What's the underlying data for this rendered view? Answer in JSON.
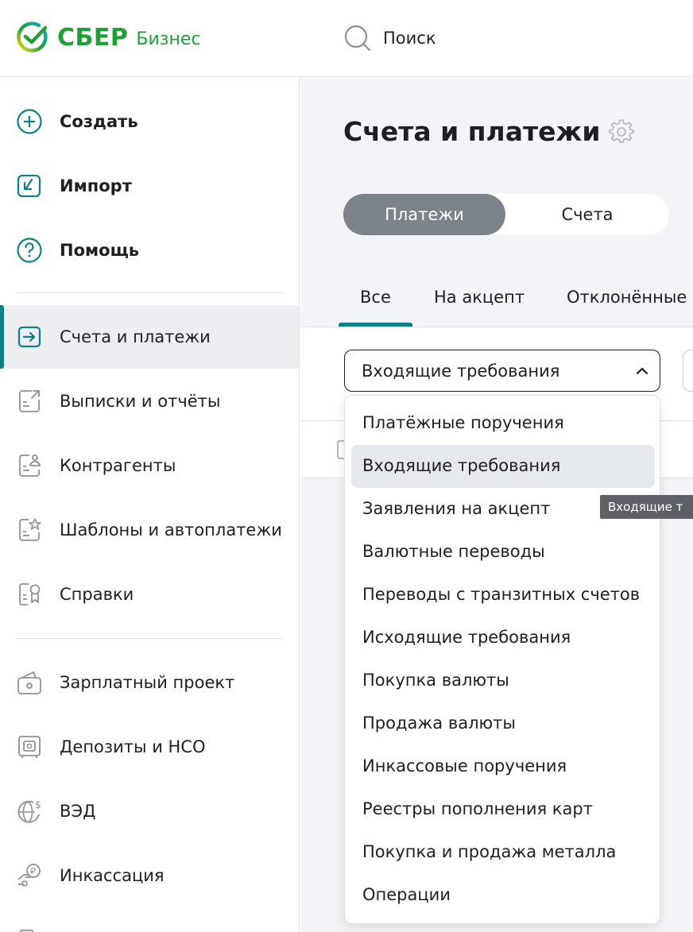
{
  "header": {
    "logo_brand": "СБЕР",
    "logo_product": "Бизнес",
    "search_label": "Поиск"
  },
  "sidebar": {
    "actions": [
      {
        "label": "Создать",
        "icon": "plus-circle-icon"
      },
      {
        "label": "Импорт",
        "icon": "import-icon"
      },
      {
        "label": "Помощь",
        "icon": "help-icon"
      }
    ],
    "nav": [
      {
        "label": "Счета и платежи",
        "icon": "arrow-box-icon",
        "active": true
      },
      {
        "label": "Выписки и отчёты",
        "icon": "statement-icon"
      },
      {
        "label": "Контрагенты",
        "icon": "contractors-icon"
      },
      {
        "label": "Шаблоны и автоплатежи",
        "icon": "templates-icon"
      },
      {
        "label": "Справки",
        "icon": "certificate-icon"
      }
    ],
    "services": [
      {
        "label": "Зарплатный проект",
        "icon": "wallet-icon"
      },
      {
        "label": "Депозиты и НСО",
        "icon": "safe-icon"
      },
      {
        "label": "ВЭД",
        "icon": "globe-dollar-icon"
      },
      {
        "label": "Инкассация",
        "icon": "hand-ruble-icon"
      }
    ]
  },
  "main": {
    "title": "Счета и платежи",
    "segment": {
      "active": "Платежи",
      "inactive": "Счета"
    },
    "tabs": [
      "Все",
      "На акцепт",
      "Отклонённые"
    ],
    "select_value": "Входящие требования",
    "dropdown_items": [
      "Платёжные поручения",
      "Входящие требования",
      "Заявления на акцепт",
      "Валютные переводы",
      "Переводы с транзитных счетов",
      "Исходящие требования",
      "Покупка валюты",
      "Продажа валюты",
      "Инкассовые поручения",
      "Реестры пополнения карт",
      "Покупка и продажа металла",
      "Операции"
    ],
    "selected_index": 1,
    "tooltip": "Входящие т"
  },
  "colors": {
    "brand_green": "#21a038",
    "accent_teal": "#107f8c",
    "segment_active": "#7d838a"
  }
}
